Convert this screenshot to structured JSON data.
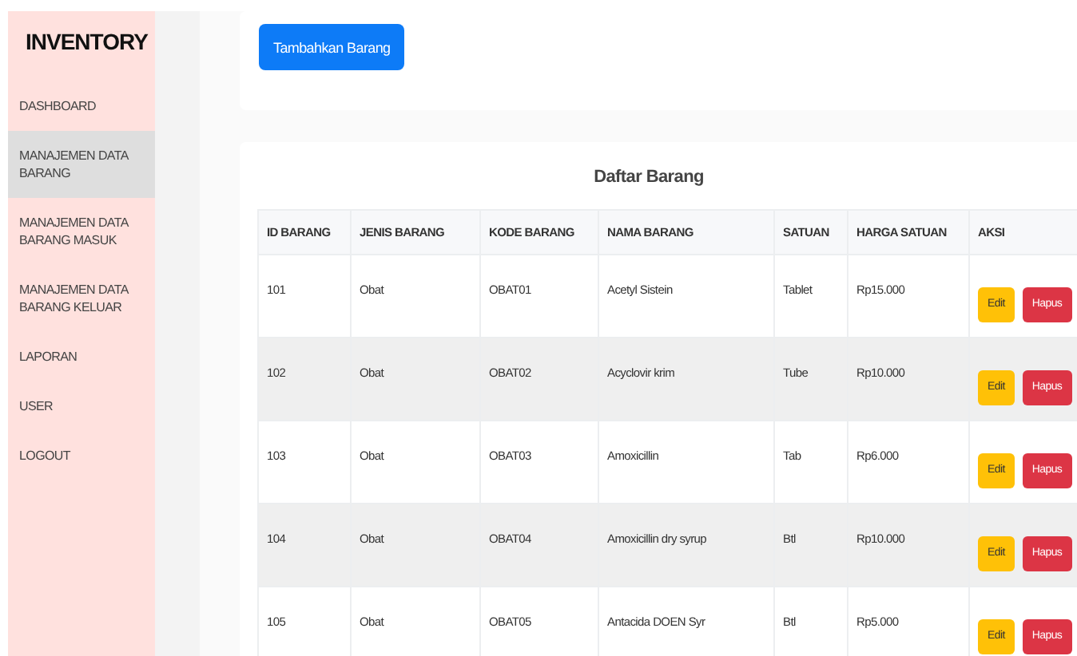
{
  "sidebar": {
    "brand": "INVENTORY",
    "items": [
      {
        "label": "DASHBOARD",
        "selected": false
      },
      {
        "label": "MANAJEMEN DATA BARANG",
        "selected": true
      },
      {
        "label": "MANAJEMEN DATA BARANG MASUK",
        "selected": false
      },
      {
        "label": "MANAJEMEN DATA BARANG KELUAR",
        "selected": false
      },
      {
        "label": "LAPORAN",
        "selected": false
      },
      {
        "label": "USER",
        "selected": false
      },
      {
        "label": "LOGOUT",
        "selected": false
      }
    ]
  },
  "add_button": "Tambahkan Barang",
  "table": {
    "title": "Daftar Barang",
    "columns": [
      "ID BARANG",
      "JENIS BARANG",
      "KODE BARANG",
      "NAMA BARANG",
      "SATUAN",
      "HARGA SATUAN",
      "AKSI"
    ],
    "rows": [
      {
        "cells": [
          "101",
          "Obat",
          "OBAT01",
          "Acetyl Sistein",
          "Tablet",
          "Rp15.000"
        ],
        "actions": [
          "Edit",
          "Hapus"
        ]
      },
      {
        "cells": [
          "102",
          "Obat",
          "OBAT02",
          "Acyclovir krim",
          "Tube",
          "Rp10.000"
        ],
        "actions": [
          "Edit",
          "Hapus"
        ]
      },
      {
        "cells": [
          "103",
          "Obat",
          "OBAT03",
          "Amoxicillin",
          "Tab",
          "Rp6.000"
        ],
        "actions": [
          "Edit",
          "Hapus"
        ]
      },
      {
        "cells": [
          "104",
          "Obat",
          "OBAT04",
          "Amoxicillin dry syrup",
          "Btl",
          "Rp10.000"
        ],
        "actions": [
          "Edit",
          "Hapus"
        ]
      },
      {
        "cells": [
          "105",
          "Obat",
          "OBAT05",
          "Antacida DOEN Syr",
          "Btl",
          "Rp5.000"
        ],
        "actions": [
          "Edit",
          "Hapus"
        ]
      }
    ]
  }
}
